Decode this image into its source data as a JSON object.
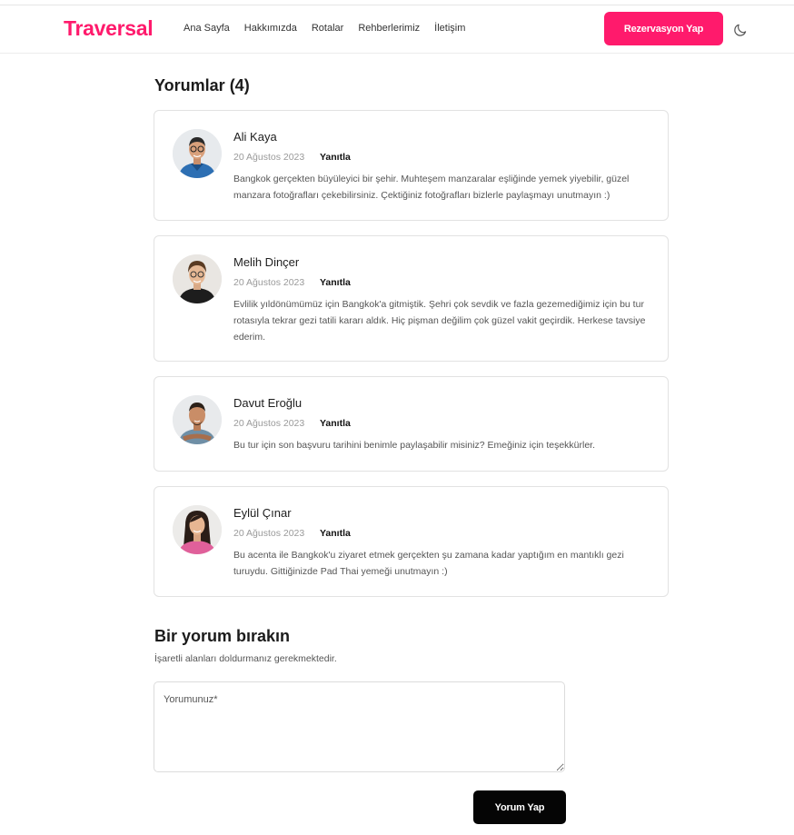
{
  "header": {
    "logo": "Traversal",
    "nav": [
      "Ana Sayfa",
      "Hakkımızda",
      "Rotalar",
      "Rehberlerimiz",
      "İletişim"
    ],
    "cta_label": "Rezervasyon Yap",
    "theme_icon": "moon-icon",
    "brand_color": "#ff1a6c"
  },
  "comments_section": {
    "title": "Yorumlar (4)",
    "reply_label": "Yanıtla",
    "items": [
      {
        "name": "Ali Kaya",
        "date": "20 Ağustos 2023",
        "text": "Bangkok gerçekten büyüleyici bir şehir. Muhteşem manzaralar eşliğinde yemek yiyebilir, güzel manzara fotoğrafları çekebilirsiniz. Çektiğiniz fotoğrafları bizlerle paylaşmayı unutmayın :)"
      },
      {
        "name": "Melih Dinçer",
        "date": "20 Ağustos 2023",
        "text": "Evlilik yıldönümümüz için Bangkok'a gitmiştik. Şehri çok sevdik ve fazla gezemediğimiz için bu tur rotasıyla tekrar gezi tatili kararı aldık. Hiç pişman değilim çok güzel vakit geçirdik. Herkese tavsiye ederim."
      },
      {
        "name": "Davut Eroğlu",
        "date": "20 Ağustos 2023",
        "text": "Bu tur için son başvuru tarihini benimle paylaşabilir misiniz? Emeğiniz için teşekkürler."
      },
      {
        "name": "Eylül Çınar",
        "date": "20 Ağustos 2023",
        "text": "Bu acenta ile Bangkok'u ziyaret etmek gerçekten şu zamana kadar yaptığım en mantıklı gezi turuydu. Gittiğinizde Pad Thai yemeği unutmayın :)"
      }
    ]
  },
  "form": {
    "title": "Bir yorum bırakın",
    "note": "İşaretli alanları doldurmanız gerekmektedir.",
    "placeholder": "Yorumunuz*",
    "value": "",
    "submit_label": "Yorum Yap"
  }
}
